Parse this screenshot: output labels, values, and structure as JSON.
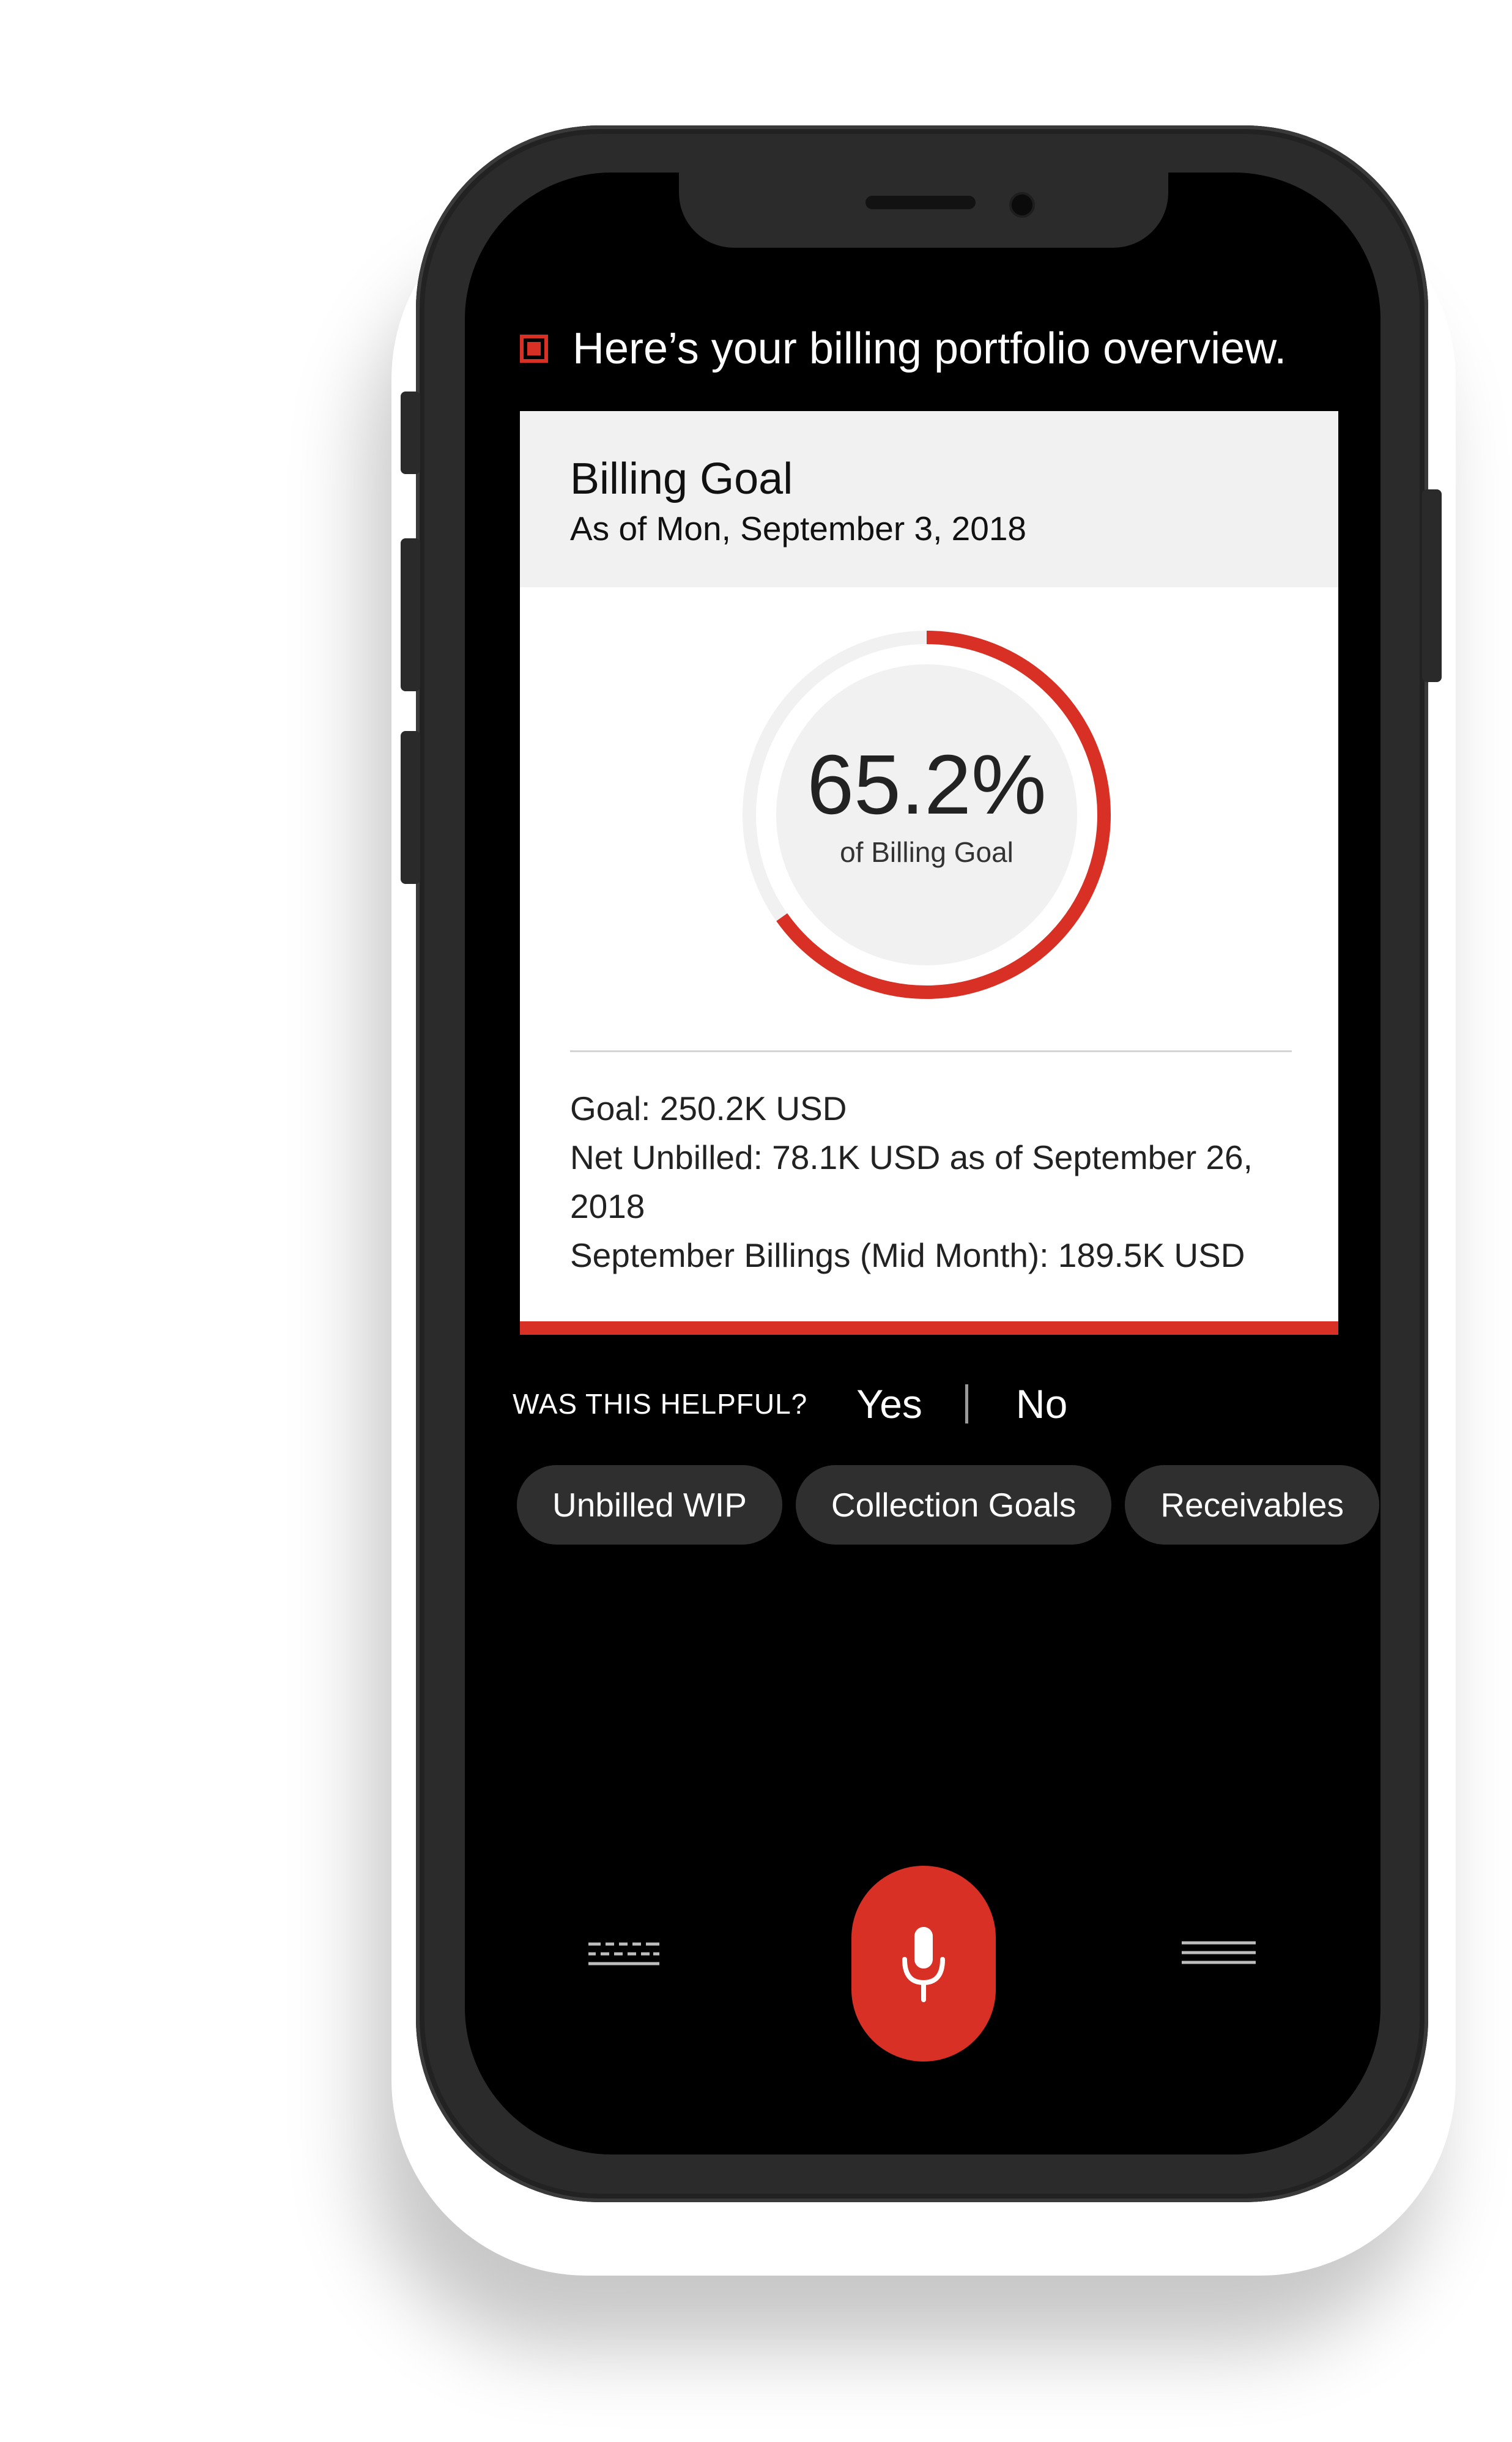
{
  "assistant": {
    "message": "Here’s your billing portfolio overview."
  },
  "card": {
    "title": "Billing Goal",
    "subtitle": "As of Mon, September 3, 2018",
    "progress": {
      "value_text": "65.2%",
      "label": "of Billing Goal",
      "percent": 65.2
    },
    "details": [
      "Goal: 250.2K USD",
      "Net Unbilled: 78.1K USD as of September 26, 2018",
      "September Billings (Mid Month): 189.5K USD"
    ]
  },
  "feedback": {
    "question": "WAS THIS HELPFUL?",
    "yes": "Yes",
    "no": "No"
  },
  "suggestions": [
    "Unbilled WIP",
    "Collection Goals",
    "Receivables"
  ],
  "icons": {
    "stop": "stop-icon",
    "keyboard": "keyboard-icon",
    "mic": "microphone-icon",
    "menu": "menu-icon"
  },
  "colors": {
    "accent": "#d93025",
    "background": "#000000",
    "card": "#ffffff",
    "card_header": "#f1f1f1",
    "chip": "#2f2f2f"
  }
}
